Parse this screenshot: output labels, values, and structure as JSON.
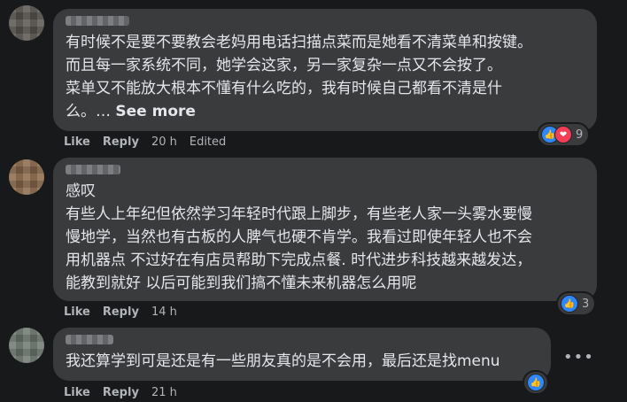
{
  "comments": [
    {
      "text": "有时候不是要不要教会老妈用电话扫描点菜而是她看不清菜单和按键。\n而且每一家系统不同，她学会这家，另一家复杂一点又不会按了。\n菜单又不能放大根本不懂有什么吃的，我有时候自己都看不清是什\n么。… ",
      "see_more": "See more",
      "like": "Like",
      "reply": "Reply",
      "time": "20 h",
      "edited": "Edited",
      "reaction_count": "9"
    },
    {
      "text": "感叹\n有些人上年纪但依然学习年轻时代跟上脚步，有些老人家一头雾水要慢\n慢地学，当然也有古板的人脾气也硬不肯学。我看过即使年轻人也不会\n用机器点 不过好在有店员帮助下完成点餐. 时代进步科技越来越发达，\n能教到就好 以后可能到我们搞不懂未来机器怎么用呢",
      "like": "Like",
      "reply": "Reply",
      "time": "14 h",
      "reaction_count": "3"
    },
    {
      "text": "我还算学到可是还是有一些朋友真的是不会用，最后还是找menu",
      "like": "Like",
      "reply": "Reply",
      "time": "21 h"
    }
  ],
  "icons": {
    "like_reaction": "thumbs-up-icon",
    "love_reaction": "heart-icon",
    "more": "more-options-icon"
  },
  "colors": {
    "background": "#18191a",
    "bubble": "#3a3b3c",
    "text": "#e4e6eb",
    "secondary_text": "#b0b3b8",
    "like_blue": "#2d88ff",
    "love_red": "#f33e58"
  }
}
